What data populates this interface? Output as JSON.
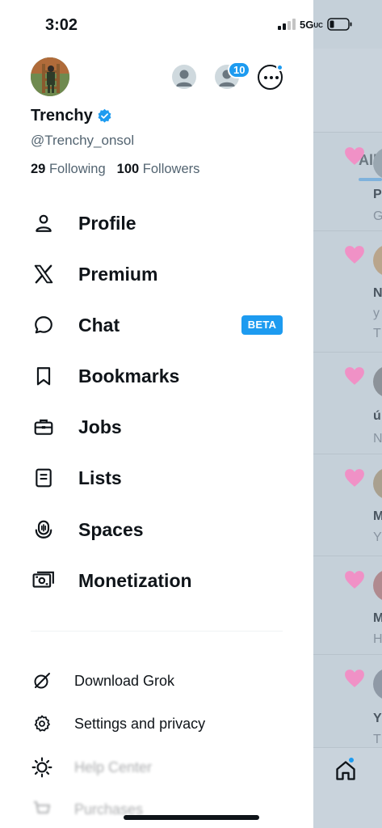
{
  "status": {
    "time": "3:02",
    "network": "5G",
    "network_suffix": "UC"
  },
  "header": {
    "badge_count": "10"
  },
  "profile": {
    "name": "Trenchy",
    "handle": "@Trenchy_onsol",
    "following_count": "29",
    "following_label": "Following",
    "followers_count": "100",
    "followers_label": "Followers"
  },
  "menu": {
    "items": [
      {
        "label": "Profile",
        "icon": "person-icon"
      },
      {
        "label": "Premium",
        "icon": "x-logo-icon"
      },
      {
        "label": "Chat",
        "icon": "chat-bubble-icon",
        "badge": "BETA"
      },
      {
        "label": "Bookmarks",
        "icon": "bookmark-icon"
      },
      {
        "label": "Jobs",
        "icon": "briefcase-icon"
      },
      {
        "label": "Lists",
        "icon": "list-icon"
      },
      {
        "label": "Spaces",
        "icon": "microphone-icon"
      },
      {
        "label": "Monetization",
        "icon": "money-icon"
      }
    ],
    "secondary": [
      {
        "label": "Download Grok",
        "icon": "grok-icon"
      },
      {
        "label": "Settings and privacy",
        "icon": "gear-icon"
      },
      {
        "label": "Help Center",
        "icon": "lightbulb-icon"
      },
      {
        "label": "Purchases",
        "icon": "cart-icon"
      }
    ]
  },
  "background_feed": {
    "tab": "All",
    "rows": [
      {
        "l1": "P",
        "l2": "G"
      },
      {
        "l1": "N",
        "l2": "y",
        "l3": "T"
      },
      {
        "l1": "ú",
        "l2": "N"
      },
      {
        "l1": "M",
        "l2": "Y"
      },
      {
        "l1": "M",
        "l2": "H"
      },
      {
        "l1": "Y",
        "l2": "T"
      }
    ]
  },
  "colors": {
    "accent": "#1d9bf0",
    "text": "#0f1419",
    "secondary_text": "#536471",
    "heart": "#f091c6"
  }
}
